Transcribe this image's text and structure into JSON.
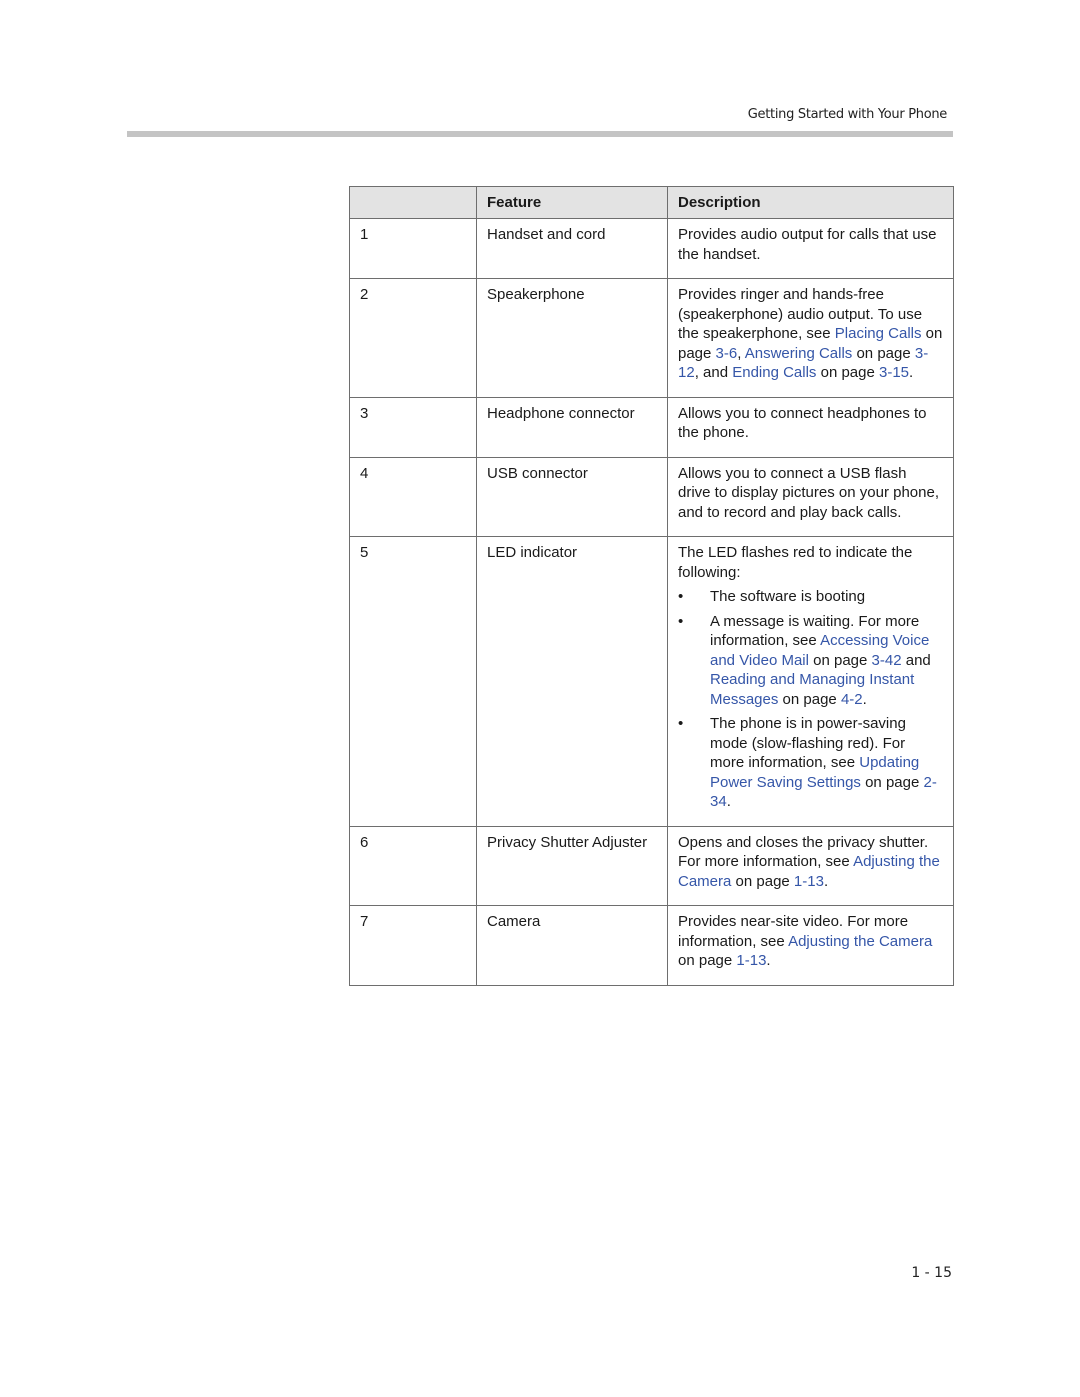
{
  "header": {
    "running_head": "Getting Started with Your Phone"
  },
  "table": {
    "columns": [
      "",
      "Feature",
      "Description"
    ],
    "rows": [
      {
        "num": "1",
        "feature": "Handset and cord",
        "desc": [
          {
            "t": "Provides audio output for calls that use the handset."
          }
        ]
      },
      {
        "num": "2",
        "feature": "Speakerphone",
        "desc": [
          {
            "t": "Provides ringer and hands-free (speakerphone) audio output. To use the speakerphone, see "
          },
          {
            "t": "Placing Calls",
            "link": true
          },
          {
            "t": " on page "
          },
          {
            "t": "3-6",
            "link": true
          },
          {
            "t": ", "
          },
          {
            "t": "Answering Calls",
            "link": true
          },
          {
            "t": " on page "
          },
          {
            "t": "3-12",
            "link": true
          },
          {
            "t": ", and "
          },
          {
            "t": "Ending Calls",
            "link": true
          },
          {
            "t": " on page "
          },
          {
            "t": "3-15",
            "link": true
          },
          {
            "t": "."
          }
        ]
      },
      {
        "num": "3",
        "feature": "Headphone connector",
        "desc": [
          {
            "t": "Allows you to connect headphones to the phone."
          }
        ]
      },
      {
        "num": "4",
        "feature": "USB connector",
        "desc": [
          {
            "t": "Allows you to connect a USB flash drive to display pictures on your phone, and to record and play back calls."
          }
        ]
      },
      {
        "num": "5",
        "feature": "LED indicator",
        "desc": [
          {
            "t": "The LED flashes red to indicate the following:"
          }
        ],
        "bullets": [
          [
            {
              "t": "The software is booting"
            }
          ],
          [
            {
              "t": "A message is waiting. For more information, see "
            },
            {
              "t": "Accessing Voice and Video Mail",
              "link": true
            },
            {
              "t": " on page "
            },
            {
              "t": "3-42",
              "link": true
            },
            {
              "t": " and "
            },
            {
              "t": "Reading and Managing Instant Messages",
              "link": true
            },
            {
              "t": " on page "
            },
            {
              "t": "4-2",
              "link": true
            },
            {
              "t": "."
            }
          ],
          [
            {
              "t": "The phone is in power-saving mode (slow-flashing red). For more information, see "
            },
            {
              "t": "Updating Power Saving Settings",
              "link": true
            },
            {
              "t": " on page "
            },
            {
              "t": "2-34",
              "link": true
            },
            {
              "t": "."
            }
          ]
        ]
      },
      {
        "num": "6",
        "feature": "Privacy Shutter Adjuster",
        "desc": [
          {
            "t": "Opens and closes the privacy shutter. For more information, see "
          },
          {
            "t": "Adjusting the Camera",
            "link": true
          },
          {
            "t": " on page "
          },
          {
            "t": "1-13",
            "link": true
          },
          {
            "t": "."
          }
        ]
      },
      {
        "num": "7",
        "feature": "Camera",
        "desc": [
          {
            "t": "Provides near-site video. For more information, see "
          },
          {
            "t": "Adjusting the Camera",
            "link": true
          },
          {
            "t": " on page "
          },
          {
            "t": "1-13",
            "link": true
          },
          {
            "t": "."
          }
        ]
      }
    ],
    "bullet_glyph": "•",
    "link_color": "#3556a8"
  },
  "footer": {
    "page_number": "1 - 15"
  }
}
